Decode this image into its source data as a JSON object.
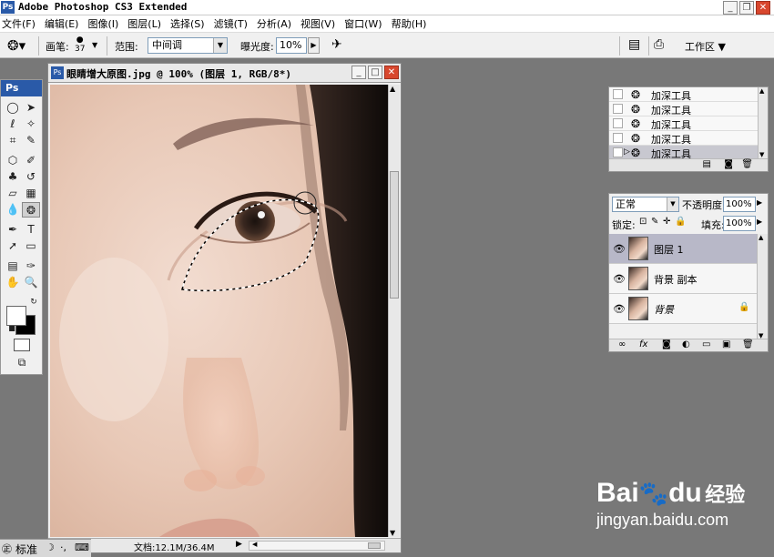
{
  "app": {
    "logo": "Ps",
    "title": "Adobe Photoshop CS3 Extended"
  },
  "menu": [
    "文件(F)",
    "编辑(E)",
    "图像(I)",
    "图层(L)",
    "选择(S)",
    "滤镜(T)",
    "分析(A)",
    "视图(V)",
    "窗口(W)",
    "帮助(H)"
  ],
  "options": {
    "brush_label": "画笔:",
    "brush_size": "37",
    "range_label": "范围:",
    "range_value": "中间调",
    "exposure_label": "曝光度:",
    "exposure_value": "10%",
    "workspace_label": "工作区"
  },
  "toolbox": {
    "header": "Ps"
  },
  "document": {
    "title": "眼睛增大原图.jpg @ 100% (图层 1, RGB/8*)",
    "status": "文档:12.1M/36.4M",
    "icon": "Ps"
  },
  "taskbar": {
    "label": "标准"
  },
  "history": {
    "items": [
      "加深工具",
      "加深工具",
      "加深工具",
      "加深工具",
      "加深工具"
    ]
  },
  "layers": {
    "blend_mode": "正常",
    "opacity_label": "不透明度:",
    "opacity_value": "100%",
    "lock_label": "锁定:",
    "fill_label": "填充:",
    "fill_value": "100%",
    "items": [
      {
        "name": "图层 1"
      },
      {
        "name": "背景 副本"
      },
      {
        "name": "背景"
      }
    ]
  },
  "watermark": {
    "brand": "Bai",
    "brand2": "du",
    "cn": "经验",
    "url": "jingyan.baidu.com"
  },
  "colors": {
    "accent": "#2a5aa8",
    "workspace_bg": "#787878",
    "close": "#d8472e"
  }
}
